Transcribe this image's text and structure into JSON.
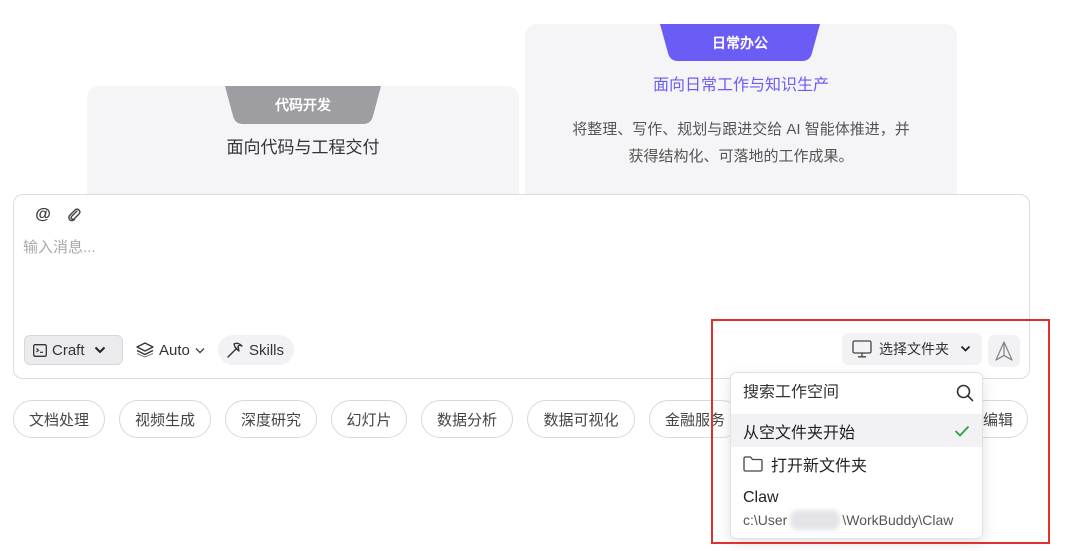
{
  "cards": {
    "left": {
      "tab": "代码开发",
      "title": "面向代码与工程交付"
    },
    "right": {
      "tab": "日常办公",
      "title": "面向日常工作与知识生产",
      "desc_line1": "将整理、写作、规划与跟进交给 AI 智能体推进，并",
      "desc_line2": "获得结构化、可落地的工作成果。"
    }
  },
  "colors": {
    "accent": "#6b5cf6",
    "tab_gray": "#9e9ea2",
    "highlight": "#e03131",
    "check": "#2f9e44"
  },
  "composer": {
    "placeholder": "输入消息...",
    "mode_label": "Craft",
    "model_label": "Auto",
    "skills_label": "Skills",
    "folder_label": "选择文件夹"
  },
  "chips": [
    "文档处理",
    "视频生成",
    "深度研究",
    "幻灯片",
    "数据分析",
    "数据可视化",
    "金融服务",
    "编辑"
  ],
  "dropdown": {
    "search_placeholder": "搜索工作空间",
    "selected_item": "从空文件夹开始",
    "open_folder": "打开新文件夹",
    "workspace_name": "Claw",
    "workspace_path_start": "c:\\User",
    "workspace_path_end": "\\WorkBuddy\\Claw"
  },
  "icons": [
    "at-icon",
    "paperclip-icon",
    "chevron-down-icon",
    "layers-icon",
    "skills-icon",
    "monitor-icon",
    "send-icon",
    "search-icon",
    "check-icon",
    "folder-icon"
  ]
}
